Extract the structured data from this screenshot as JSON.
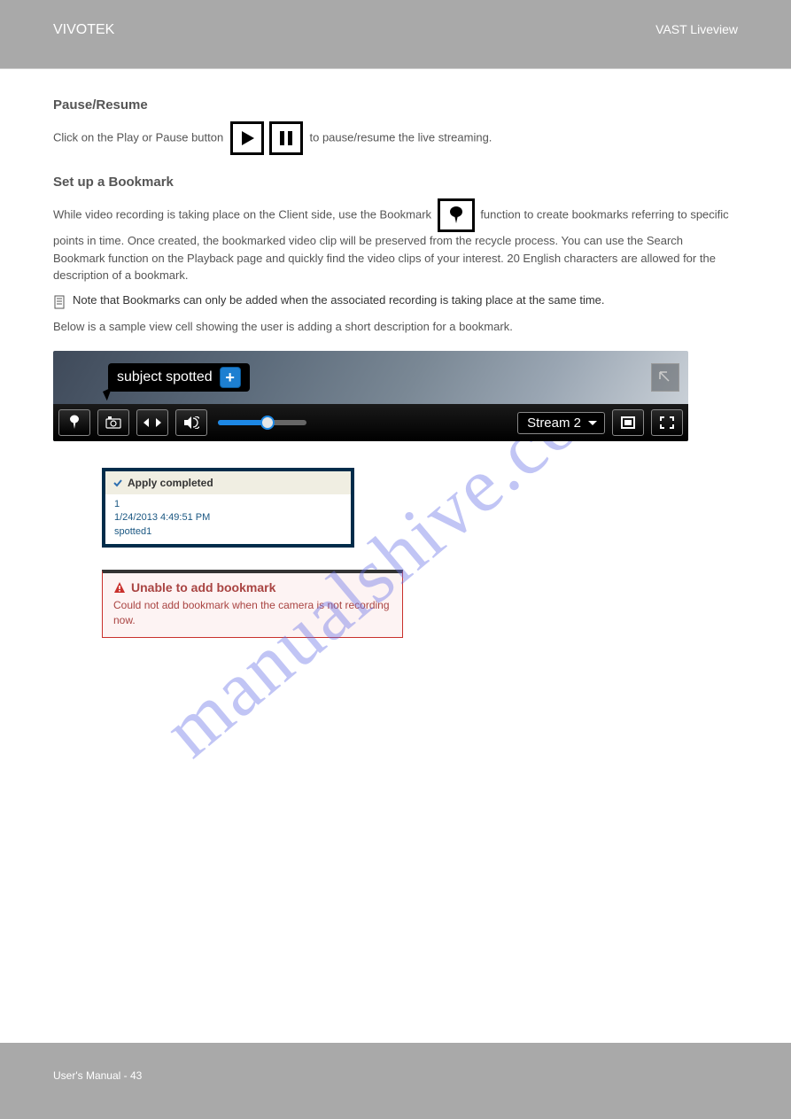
{
  "header": {
    "left": "VIVOTEK",
    "right": "VAST Liveview"
  },
  "watermark": "manualshive.com",
  "s1": {
    "heading": "Pause/Resume",
    "p1a": "Click on the Play or Pause button",
    "p1b": "to pause/resume the live streaming."
  },
  "s2": {
    "heading": "Set up a Bookmark",
    "intro_a": "While video recording is taking place on the Client side, use the Bookmark",
    "intro_b": "function to create bookmarks referring to specific points in time. Once created, the bookmarked video clip will be preserved from the recycle process. You can use the Search Bookmark function on the Playback page and quickly find the video clips of your interest. 20 English characters are allowed for the description of a bookmark.",
    "note": "Note that Bookmarks can only be added when the associated recording is taking place at the same time.",
    "below": "Below is a sample view cell showing the user is adding a short description for a bookmark."
  },
  "video": {
    "bubble_text": "subject spotted",
    "plus": "+",
    "stream_label": "Stream 2"
  },
  "success": {
    "title": "Apply completed",
    "line1": "1",
    "line2": "1/24/2013 4:49:51 PM",
    "line3": "spotted1"
  },
  "error": {
    "title": "Unable to add bookmark",
    "body": "Could not add bookmark when the camera is not recording now."
  },
  "foot": {
    "left": "User's Manual - 43",
    "right": ""
  }
}
